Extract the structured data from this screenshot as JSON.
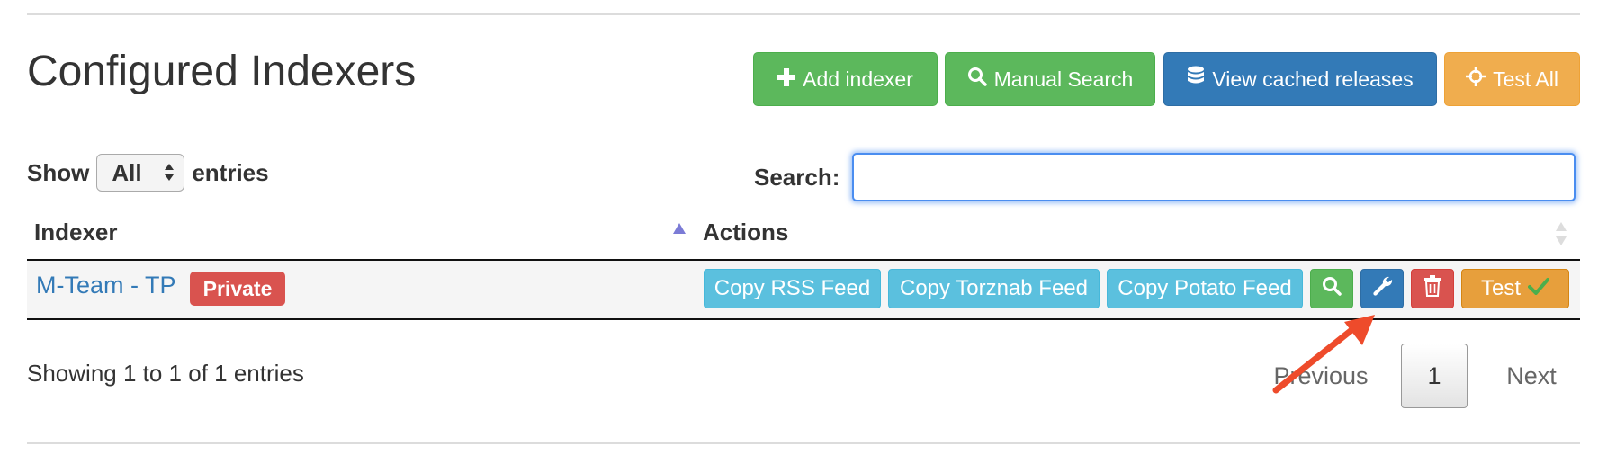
{
  "page": {
    "title": "Configured Indexers"
  },
  "toolbar": {
    "add_indexer": "Add indexer",
    "manual_search": "Manual Search",
    "view_cached": "View cached releases",
    "test_all": "Test All"
  },
  "length_control": {
    "prefix": "Show",
    "selected": "All",
    "suffix": "entries"
  },
  "search": {
    "label": "Search:",
    "value": ""
  },
  "table": {
    "columns": [
      "Indexer",
      "Actions"
    ],
    "rows": [
      {
        "indexer": "M-Team - TP",
        "badge": "Private",
        "actions": {
          "copy_rss": "Copy RSS Feed",
          "copy_torznab": "Copy Torznab Feed",
          "copy_potato": "Copy Potato Feed",
          "test": "Test"
        }
      }
    ]
  },
  "footer": {
    "info": "Showing 1 to 1 of 1 entries",
    "previous": "Previous",
    "current_page": "1",
    "next": "Next"
  },
  "icons": {
    "add": "plus-icon",
    "search": "search-icon",
    "cache": "database-icon",
    "test_all": "crosshair-icon",
    "configure": "wrench-icon",
    "delete": "trash-icon",
    "test_ok": "checkmark-icon"
  },
  "colors": {
    "success": "#5cb85c",
    "primary": "#337ab7",
    "warning": "#f0ad4e",
    "info": "#5bc0de",
    "danger": "#d9534f",
    "link": "#337ab7",
    "focus": "#4a8df0",
    "annotation_arrow": "#ee4b2b"
  }
}
